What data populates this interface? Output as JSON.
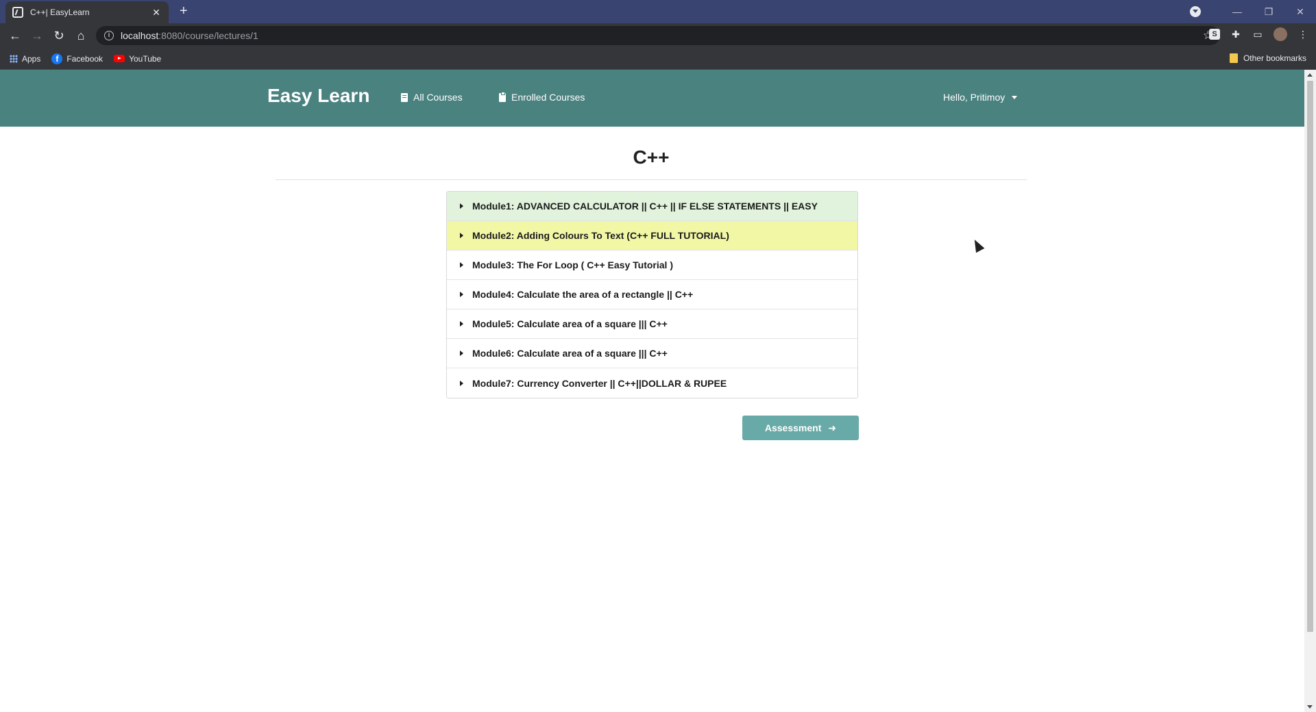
{
  "browser": {
    "tab_title": "C++| EasyLearn",
    "new_tab": "+",
    "url_host": "localhost",
    "url_rest": ":8080/course/lectures/1",
    "bookmarks": [
      "Apps",
      "Facebook",
      "YouTube"
    ],
    "other_bookmarks": "Other bookmarks",
    "facebook_glyph": "f"
  },
  "navbar": {
    "brand": "Easy Learn",
    "all_courses": "All Courses",
    "enrolled_courses": "Enrolled Courses",
    "user_greeting": "Hello, Pritimoy",
    "color": "#4a8280"
  },
  "course": {
    "title": "C++",
    "modules": [
      {
        "label": "Module1: ADVANCED CALCULATOR || C++ || IF ELSE STATEMENTS || EASY",
        "state": "done"
      },
      {
        "label": "Module2: Adding Colours To Text (C++ FULL TUTORIAL)",
        "state": "active"
      },
      {
        "label": "Module3: The For Loop ( C++ Easy Tutorial )",
        "state": "default"
      },
      {
        "label": "Module4: Calculate the area of a rectangle || C++",
        "state": "default"
      },
      {
        "label": "Module5: Calculate area of a square ||| C++",
        "state": "default"
      },
      {
        "label": "Module6: Calculate area of a square ||| C++",
        "state": "default"
      },
      {
        "label": "Module7: Currency Converter || C++||DOLLAR & RUPEE",
        "state": "default"
      }
    ],
    "assessment_button": "Assessment",
    "colors": {
      "done": "#e1f3dc",
      "active": "#f2f7a6",
      "button": "#67aaa7"
    }
  }
}
